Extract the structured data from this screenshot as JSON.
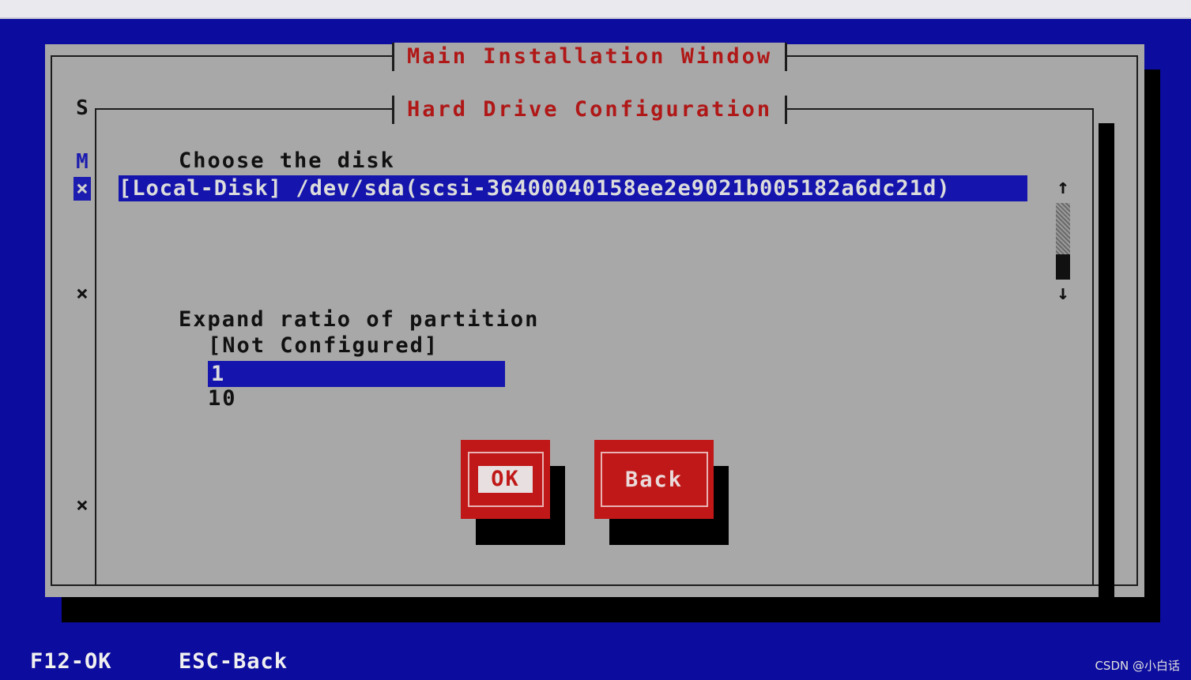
{
  "main_window": {
    "title": "Main Installation Window"
  },
  "dialog": {
    "title": "Hard Drive Configuration",
    "choose_disk_label": "Choose the disk",
    "disk_items": [
      "[Local-Disk] /dev/sda(scsi-36400040158ee2e9021b005182a6dc21d)"
    ],
    "expand_ratio_label": "Expand ratio of partition",
    "ratio_options": [
      "[Not Configured]",
      "1",
      "10"
    ],
    "ok_button": "OK",
    "back_button": "Back"
  },
  "side_markers": [
    "S",
    "M",
    "×",
    "×",
    "×"
  ],
  "scrollbar": {
    "up": "↑",
    "down": "↓"
  },
  "footer": {
    "f12": "F12-OK",
    "esc": "ESC-Back"
  },
  "watermark": "CSDN @小白话",
  "colors": {
    "screen_bg": "#0c0c9e",
    "window_bg": "#a8a8a8",
    "title_red": "#b01818",
    "selection_blue": "#1515ad",
    "button_red": "#c01818"
  }
}
